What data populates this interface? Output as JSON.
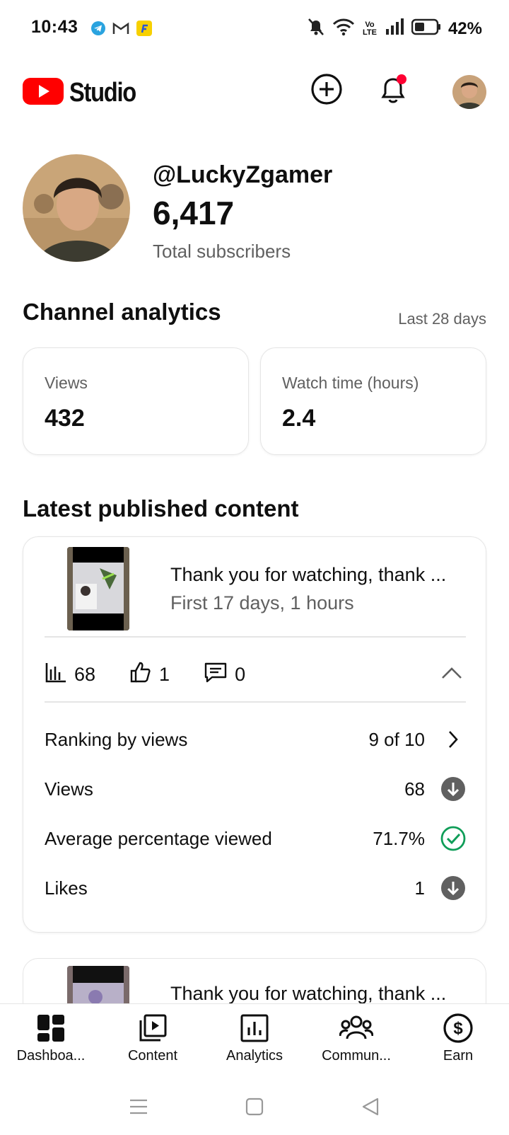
{
  "status_bar": {
    "time": "10:43",
    "battery": "42%",
    "network": "Vo LTE"
  },
  "header": {
    "logo_text": "Studio",
    "brand_color": "#ff0000"
  },
  "channel": {
    "handle": "@LuckyZgamer",
    "subscribers": "6,417",
    "subscribers_label": "Total subscribers"
  },
  "analytics": {
    "title": "Channel analytics",
    "range": "Last 28 days",
    "cards": [
      {
        "label": "Views",
        "value": "432"
      },
      {
        "label": "Watch time (hours)",
        "value": "2.4"
      }
    ]
  },
  "latest": {
    "title": "Latest published content",
    "video": {
      "title": "Thank you for watching, thank ...",
      "subtitle": "First 17 days, 1 hours",
      "views": "68",
      "likes": "1",
      "comments": "0",
      "details": [
        {
          "label": "Ranking by views",
          "value": "9 of 10",
          "icon": "chevron-right-icon"
        },
        {
          "label": "Views",
          "value": "68",
          "icon": "arrow-down-circle-icon"
        },
        {
          "label": "Average percentage viewed",
          "value": "71.7%",
          "icon": "check-circle-icon"
        },
        {
          "label": "Likes",
          "value": "1",
          "icon": "arrow-down-circle-icon"
        }
      ]
    },
    "video2": {
      "title": "Thank you for watching, thank ..."
    }
  },
  "bottom_nav": [
    {
      "label": "Dashboa...",
      "icon": "dashboard-icon"
    },
    {
      "label": "Content",
      "icon": "content-icon"
    },
    {
      "label": "Analytics",
      "icon": "analytics-icon"
    },
    {
      "label": "Commun...",
      "icon": "community-icon"
    },
    {
      "label": "Earn",
      "icon": "earn-icon"
    }
  ],
  "colors": {
    "success": "#0f9d58",
    "muted_icon": "#606060",
    "notification_dot": "#ff0033"
  }
}
